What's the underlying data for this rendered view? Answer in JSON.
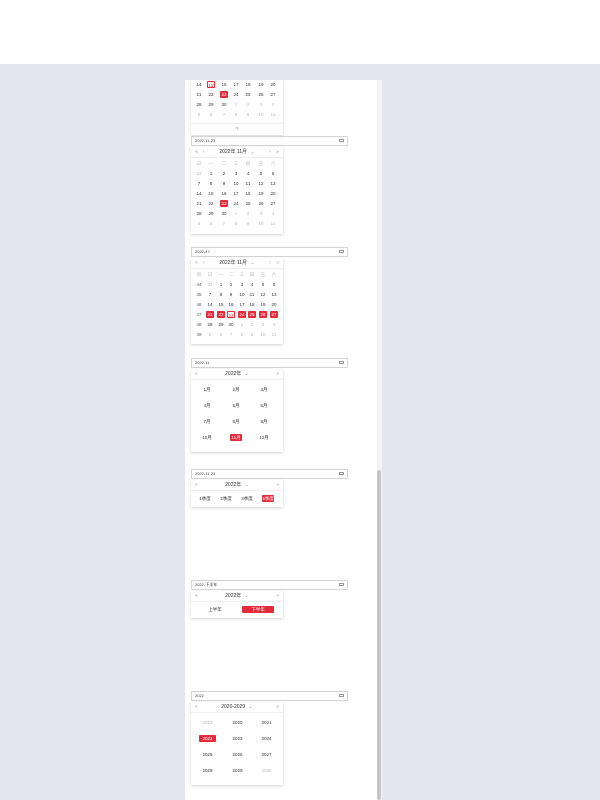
{
  "colors": {
    "accent": "#e42b3a",
    "background": "#e3e6ee"
  },
  "block1": {
    "rows": [
      [
        "14",
        "15",
        "16",
        "17",
        "18",
        "19",
        "20"
      ],
      [
        "21",
        "22",
        "23",
        "24",
        "25",
        "26",
        "27"
      ],
      [
        "28",
        "29",
        "30",
        "1",
        "2",
        "3",
        "4"
      ],
      [
        "5",
        "6",
        "7",
        "8",
        "9",
        "10",
        "11"
      ]
    ],
    "footer": "今"
  },
  "block2": {
    "input_value": "2022-11-23",
    "header": "2022年 11月",
    "weekdays": [
      "日",
      "一",
      "二",
      "三",
      "四",
      "五",
      "六"
    ],
    "rows": [
      [
        "31",
        "1",
        "2",
        "3",
        "4",
        "5",
        "6"
      ],
      [
        "7",
        "8",
        "9",
        "10",
        "11",
        "12",
        "13"
      ],
      [
        "14",
        "15",
        "16",
        "17",
        "18",
        "19",
        "20"
      ],
      [
        "21",
        "22",
        "23",
        "24",
        "25",
        "26",
        "27"
      ],
      [
        "28",
        "29",
        "30",
        "1",
        "2",
        "3",
        "4"
      ],
      [
        "5",
        "6",
        "7",
        "8",
        "9",
        "10",
        "11"
      ]
    ]
  },
  "block3": {
    "input_value": "2022-47",
    "header": "2022年 11月",
    "weekdays": [
      "周",
      "日",
      "一",
      "二",
      "三",
      "四",
      "五",
      "六"
    ],
    "rows": [
      [
        "44",
        "31",
        "1",
        "2",
        "3",
        "4",
        "5",
        "6"
      ],
      [
        "45",
        "7",
        "8",
        "9",
        "10",
        "11",
        "12",
        "13"
      ],
      [
        "46",
        "14",
        "15",
        "16",
        "17",
        "18",
        "19",
        "20"
      ],
      [
        "47",
        "21",
        "22",
        "23",
        "24",
        "25",
        "26",
        "27"
      ],
      [
        "48",
        "28",
        "29",
        "30",
        "1",
        "2",
        "3",
        "4"
      ],
      [
        "49",
        "5",
        "6",
        "7",
        "8",
        "9",
        "10",
        "11"
      ]
    ]
  },
  "block4": {
    "input_value": "2022-11",
    "header": "2022年",
    "months": [
      "1月",
      "2月",
      "3月",
      "4月",
      "5月",
      "6月",
      "7月",
      "8月",
      "9月",
      "10月",
      "11月",
      "12月"
    ]
  },
  "block5": {
    "input_value": "2022-11-23",
    "header": "2022年",
    "quarters": [
      "1季度",
      "2季度",
      "3季度",
      "4季度"
    ]
  },
  "block6": {
    "input_value": "2022-下半年",
    "header": "2022年",
    "halves": [
      "上半年",
      "下半年"
    ]
  },
  "block7": {
    "input_value": "2022",
    "header": "2020-2029",
    "years": [
      "2019",
      "2020",
      "2021",
      "2022",
      "2023",
      "2024",
      "2025",
      "2026",
      "2027",
      "2028",
      "2029",
      "2030"
    ]
  }
}
